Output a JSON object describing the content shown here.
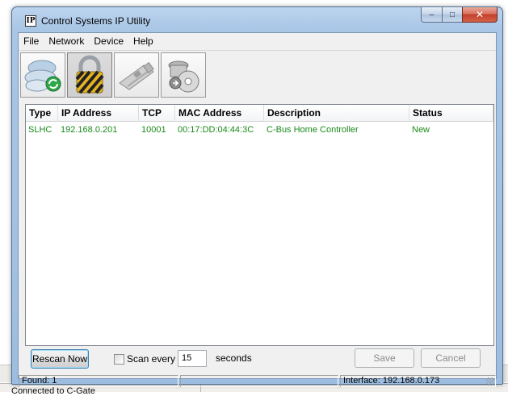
{
  "window": {
    "title": "Control Systems IP Utility",
    "icon_letters": "IP",
    "controls": {
      "minimize": "–",
      "maximize": "□",
      "close": "✕"
    }
  },
  "menu": [
    "File",
    "Network",
    "Device",
    "Help"
  ],
  "toolbar": [
    {
      "icon": "network-cloud-icon",
      "pressed": false
    },
    {
      "icon": "lock-icon",
      "pressed": true
    },
    {
      "icon": "network-card-icon",
      "pressed": false
    },
    {
      "icon": "disc-tools-icon",
      "pressed": false
    }
  ],
  "table": {
    "columns": [
      "Type",
      "IP Address",
      "TCP",
      "MAC Address",
      "Description",
      "Status"
    ],
    "rows": [
      {
        "type": "SLHC",
        "ip": "192.168.0.201",
        "tcp": "10001",
        "mac": "00:17:DD:04:44:3C",
        "description": "C-Bus Home Controller",
        "status": "New"
      }
    ],
    "row_color": "#1a8a1a"
  },
  "controls": {
    "rescan_label": "Rescan Now",
    "scan_every_label": "Scan every",
    "scan_every_checked": false,
    "interval_value": "15",
    "seconds_label": "seconds",
    "save_label": "Save",
    "cancel_label": "Cancel"
  },
  "status": {
    "found": "Found: 1",
    "interface": "Interface: 192.168.0.173"
  },
  "background": {
    "status_text": "Connected to C-Gate"
  }
}
